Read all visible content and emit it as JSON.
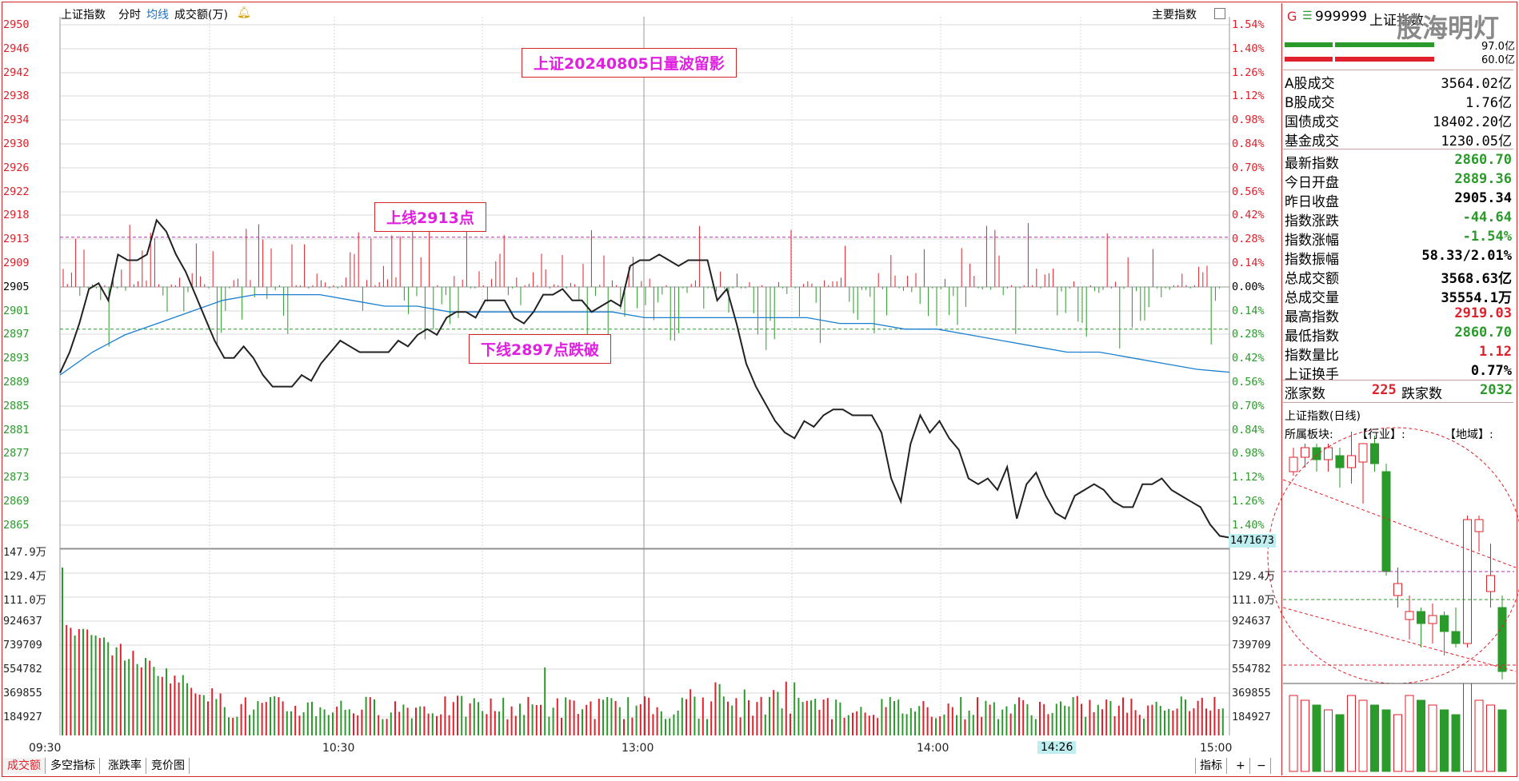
{
  "header": {
    "index_name": "上证指数",
    "tab_minute": "分时",
    "tab_avg": "均线",
    "tab_volume": "成交额(万)",
    "main_indicator": "主要指数"
  },
  "left_axis_prices": [
    "2950",
    "2946",
    "2942",
    "2938",
    "2934",
    "2930",
    "2926",
    "2922",
    "2918",
    "2913",
    "2909",
    "2905",
    "2901",
    "2897",
    "2893",
    "2889",
    "2885",
    "2881",
    "2877",
    "2873",
    "2869",
    "2865"
  ],
  "right_axis_pcts": [
    "1.54%",
    "1.40%",
    "1.26%",
    "1.12%",
    "0.98%",
    "0.84%",
    "0.70%",
    "0.56%",
    "0.42%",
    "0.28%",
    "0.14%",
    "0.00%",
    "0.14%",
    "0.28%",
    "0.42%",
    "0.56%",
    "0.70%",
    "0.84%",
    "0.98%",
    "1.12%",
    "1.26%",
    "1.40%"
  ],
  "vol_axis_left": [
    "147.9万",
    "129.4万",
    "111.0万",
    "924637",
    "739709",
    "554782",
    "369855",
    "184927"
  ],
  "vol_axis_right": [
    "147.9万",
    "129.4万",
    "111.0万",
    "924637",
    "739709",
    "554782",
    "369855",
    "184927"
  ],
  "cursor_readout": "1471673",
  "time_labels": [
    "09:30",
    "10:30",
    "13:00",
    "14:00",
    "15:00"
  ],
  "cursor_time": "14:26",
  "annotations": {
    "title": "上证20240805日量波留影",
    "upper": "上线2913点",
    "lower": "下线2897点跌破"
  },
  "bottom_tabs": [
    "成交额",
    "多空指标",
    "涨跌率",
    "竞价图"
  ],
  "bottom_right": {
    "indicator": "指标",
    "plus": "+",
    "minus": "−"
  },
  "right_panel": {
    "code_prefix": "G",
    "code": "999999",
    "name": "上证指数",
    "watermark": "股海明灯",
    "bar1_val": "97.0亿",
    "bar2_val": "60.0亿",
    "turnover": [
      {
        "k": "A股成交",
        "v": "3564.02亿"
      },
      {
        "k": "B股成交",
        "v": "1.76亿"
      },
      {
        "k": "国债成交",
        "v": "18402.20亿"
      },
      {
        "k": "基金成交",
        "v": "1230.05亿"
      }
    ],
    "stats": [
      {
        "k": "最新指数",
        "v": "2860.70",
        "c": "green"
      },
      {
        "k": "今日开盘",
        "v": "2889.36",
        "c": "green"
      },
      {
        "k": "昨日收盘",
        "v": "2905.34",
        "c": "black"
      },
      {
        "k": "指数涨跌",
        "v": "-44.64",
        "c": "green"
      },
      {
        "k": "指数涨幅",
        "v": "-1.54%",
        "c": "green"
      },
      {
        "k": "指数振幅",
        "v": "58.33/2.01%",
        "c": "black"
      },
      {
        "k": "总成交额",
        "v": "3568.63亿",
        "c": "black"
      },
      {
        "k": "总成交量",
        "v": "35554.1万",
        "c": "black"
      },
      {
        "k": "最高指数",
        "v": "2919.03",
        "c": "red"
      },
      {
        "k": "最低指数",
        "v": "2860.70",
        "c": "green"
      },
      {
        "k": "指数量比",
        "v": "1.12",
        "c": "red"
      },
      {
        "k": "上证换手",
        "v": "0.77%",
        "c": "black"
      }
    ],
    "up_label": "涨家数",
    "up_count": "225",
    "down_label": "跌家数",
    "down_count": "2032",
    "daily_title": "上证指数(日线)",
    "sector_label": "所属板块:",
    "industry_label": "【行业】:",
    "region_label": "【地域】:"
  },
  "colors": {
    "up": "#e0202a",
    "down": "#2a9a2a",
    "avg": "#1a7fd0",
    "price": "#222222",
    "grid": "#d8d8d8",
    "frame": "#d2262b",
    "annot": "#e020e0"
  },
  "chart_data": {
    "type": "line",
    "prev_close": 2905.34,
    "upper_line": 2913,
    "lower_line": 2897,
    "ylim": [
      2863,
      2950
    ],
    "x_sessions": [
      "09:30",
      "10:30",
      "11:30/13:00",
      "14:00",
      "15:00"
    ],
    "series": [
      {
        "values": [
          2889.36,
          2893,
          2898,
          2904,
          2905,
          2902,
          2910,
          2909,
          2909,
          2910,
          2916,
          2914,
          2910,
          2907,
          2903,
          2899,
          2895,
          2892,
          2892,
          2894,
          2892,
          2889,
          2887,
          2887,
          2887,
          2889,
          2888,
          2891,
          2893,
          2895,
          2894,
          2893,
          2893,
          2893,
          2893,
          2895,
          2894,
          2896,
          2897,
          2896,
          2899,
          2900,
          2900,
          2899,
          2902,
          2902,
          2902,
          2899,
          2898,
          2900,
          2903,
          2903,
          2904,
          2902,
          2902,
          2900,
          2901,
          2902,
          2901,
          2908,
          2909,
          2909,
          2910,
          2909,
          2908,
          2909,
          2909,
          2909,
          2902,
          2904,
          2898,
          2891,
          2887,
          2884,
          2881,
          2879,
          2878,
          2881,
          2880,
          2882,
          2883,
          2883,
          2882,
          2882,
          2882,
          2879,
          2871,
          2867,
          2877,
          2882,
          2879,
          2881,
          2878,
          2876,
          2871,
          2870,
          2871,
          2869,
          2873,
          2864,
          2870,
          2872,
          2868,
          2865,
          2864,
          2868,
          2869,
          2870,
          2869,
          2867,
          2866,
          2866,
          2870,
          2870,
          2871,
          2869,
          2868,
          2867,
          2866,
          2863,
          2861,
          2860.7
        ]
      },
      {
        "values": [
          2889,
          2893,
          2896,
          2898,
          2900,
          2902,
          2903,
          2903,
          2903,
          2902,
          2901,
          2901,
          2900,
          2900,
          2900,
          2900,
          2900,
          2900,
          2899,
          2899,
          2899,
          2899,
          2899,
          2899,
          2898,
          2898,
          2897,
          2897,
          2896,
          2895,
          2894,
          2893,
          2893,
          2892,
          2891,
          2890,
          2889.5
        ]
      }
    ]
  }
}
